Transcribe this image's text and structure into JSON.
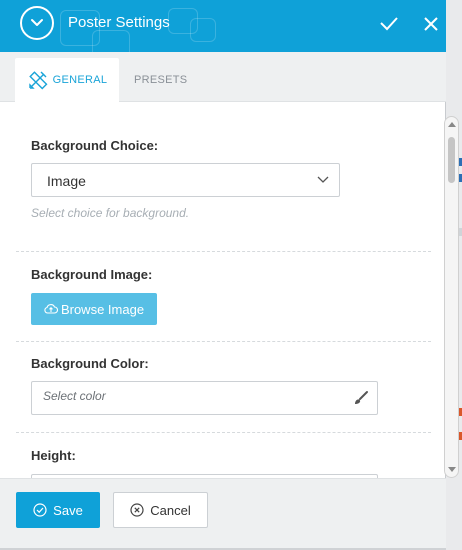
{
  "dialog": {
    "title": "Poster Settings",
    "icons": {
      "collapse": "chevron-down-icon",
      "confirm": "checkmark-icon",
      "close": "close-icon"
    }
  },
  "tabs": [
    {
      "label": "General",
      "icon": "pencil-ruler-icon",
      "active": true
    },
    {
      "label": "Presets",
      "active": false
    }
  ],
  "fields": {
    "background_choice": {
      "label": "Background Choice:",
      "value": "Image",
      "help": "Select choice for background."
    },
    "background_image": {
      "label": "Background Image:",
      "button_label": "Browse Image",
      "button_icon": "cloud-upload-icon"
    },
    "background_color": {
      "label": "Background Color:",
      "placeholder": "Select color",
      "icon": "brush-icon"
    },
    "height": {
      "label": "Height:"
    }
  },
  "footer": {
    "save_label": "Save",
    "cancel_label": "Cancel"
  },
  "colors": {
    "primary": "#0fa1d8",
    "button_light": "#57bfe5",
    "tab_active_text": "#1aa4d8",
    "tab_bar": "#eef0f1",
    "help_text": "#a7aeb4"
  }
}
